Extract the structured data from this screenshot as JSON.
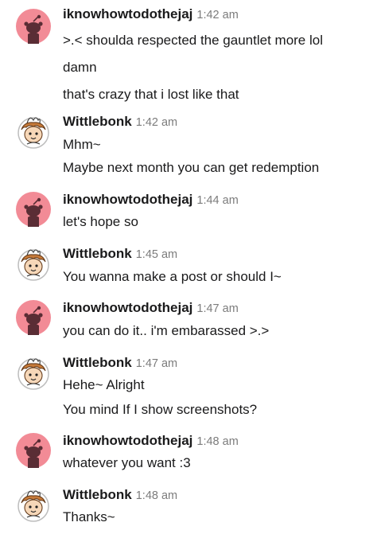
{
  "messages": [
    {
      "user": "iknowhowtodothejaj",
      "avatar": "snoo-pink-avatar-icon",
      "time": "1:42 am",
      "lines": [
        ">.< shoulda respected the gauntlet more lol",
        "damn",
        "that's crazy that i lost like that"
      ]
    },
    {
      "user": "Wittlebonk",
      "avatar": "custom-character-avatar-icon",
      "time": "1:42 am",
      "lines": [
        "Mhm~",
        "Maybe next month you can get redemption"
      ]
    },
    {
      "user": "iknowhowtodothejaj",
      "avatar": "snoo-pink-avatar-icon",
      "time": "1:44 am",
      "lines": [
        "let's hope so"
      ]
    },
    {
      "user": "Wittlebonk",
      "avatar": "custom-character-avatar-icon",
      "time": "1:45 am",
      "lines": [
        "You wanna make a post or should I~"
      ]
    },
    {
      "user": "iknowhowtodothejaj",
      "avatar": "snoo-pink-avatar-icon",
      "time": "1:47 am",
      "lines": [
        "you can do it.. i'm embarassed >.>"
      ]
    },
    {
      "user": "Wittlebonk",
      "avatar": "custom-character-avatar-icon",
      "time": "1:47 am",
      "lines": [
        "Hehe~ Alright",
        "You mind If I show screenshots?"
      ]
    },
    {
      "user": "iknowhowtodothejaj",
      "avatar": "snoo-pink-avatar-icon",
      "time": "1:48 am",
      "lines": [
        "whatever you want :3"
      ]
    },
    {
      "user": "Wittlebonk",
      "avatar": "custom-character-avatar-icon",
      "time": "1:48 am",
      "lines": [
        "Thanks~"
      ]
    }
  ],
  "colors": {
    "pink_avatar": "#f28b96",
    "text": "#1a1a1b",
    "timestamp": "#7c7c7c"
  }
}
